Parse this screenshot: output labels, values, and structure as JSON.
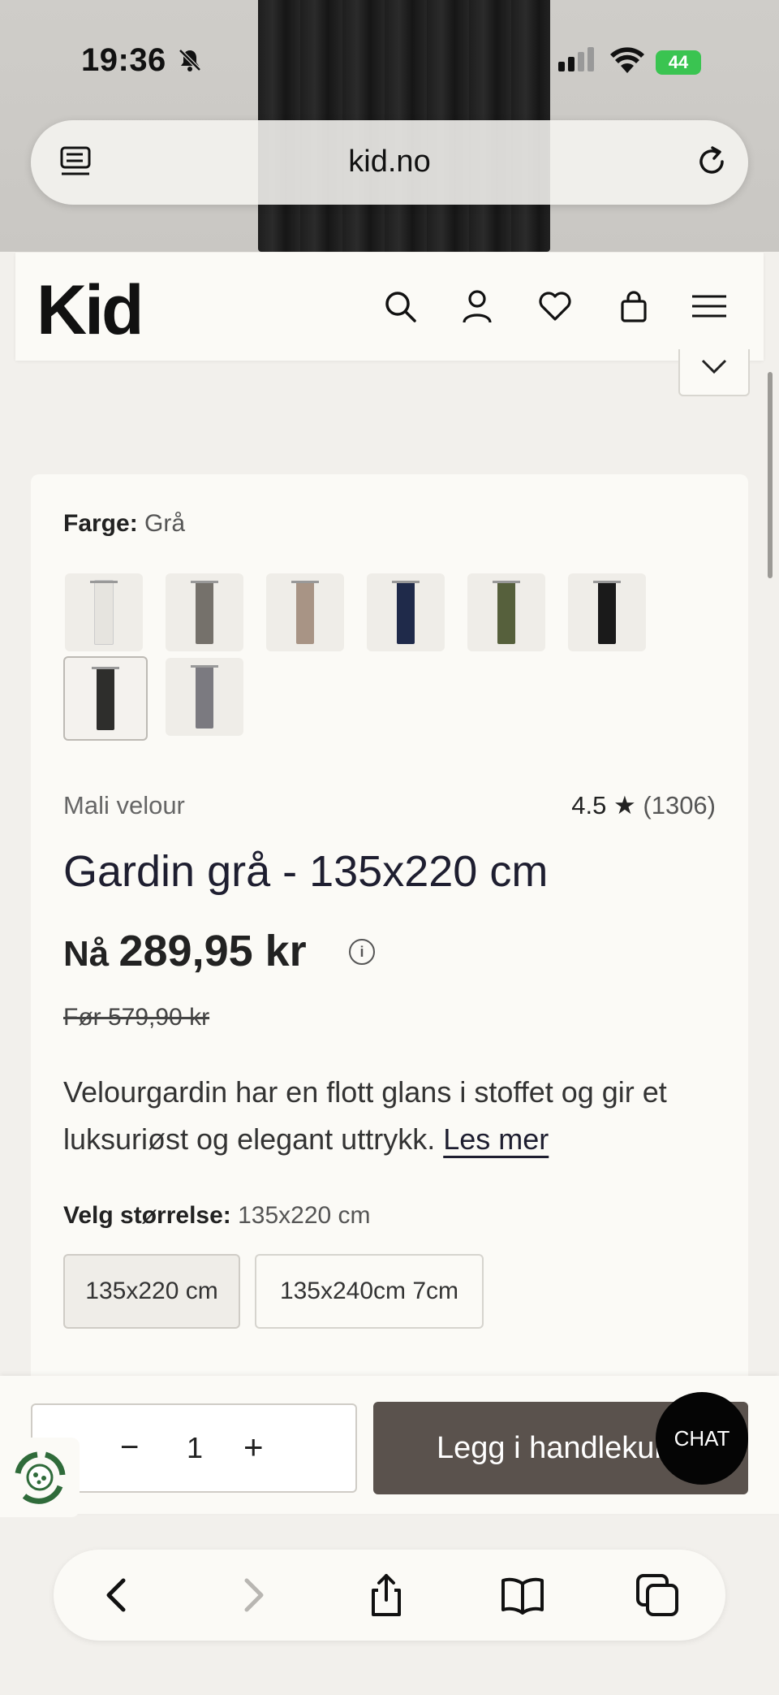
{
  "status_bar": {
    "time": "19:36",
    "battery": "44"
  },
  "browser": {
    "url": "kid.no"
  },
  "site": {
    "logo": "Kid",
    "header_icons": [
      "search-icon",
      "account-icon",
      "wishlist-heart-icon",
      "cart-bag-icon",
      "menu-icon"
    ]
  },
  "product": {
    "color_label": "Farge:",
    "color_value": "Grå",
    "swatches": [
      {
        "color": "#e6e4df"
      },
      {
        "color": "#75716b"
      },
      {
        "color": "#a89485"
      },
      {
        "color": "#1f2a4a"
      },
      {
        "color": "#56603c"
      },
      {
        "color": "#1a1a1a"
      },
      {
        "color": "#2e2e2c"
      },
      {
        "color": "#7b7a80"
      }
    ],
    "selected_swatch_index": 6,
    "brand": "Mali velour",
    "rating": "4.5 ★",
    "review_count": "(1306)",
    "title": "Gardin grå - 135x220 cm",
    "price_prefix": "Nå",
    "price_now": "289,95 kr",
    "price_before": "Før 579,90 kr",
    "description": "Velourgardin har en flott glans i stoffet og gir et luksuriøst og elegant uttrykk.",
    "read_more": "Les mer",
    "size_label": "Velg størrelse:",
    "size_value": "135x220 cm",
    "sizes": [
      "135x220 cm",
      "135x240cm 7cm"
    ]
  },
  "purchase": {
    "quantity": "1",
    "minus": "−",
    "plus": "+",
    "add_to_cart": "Legg i handlekurv",
    "chat": "CHAT"
  },
  "colors": {
    "accent_button": "#5a524d",
    "background": "#f2f0ec",
    "card": "#fbfaf6"
  }
}
